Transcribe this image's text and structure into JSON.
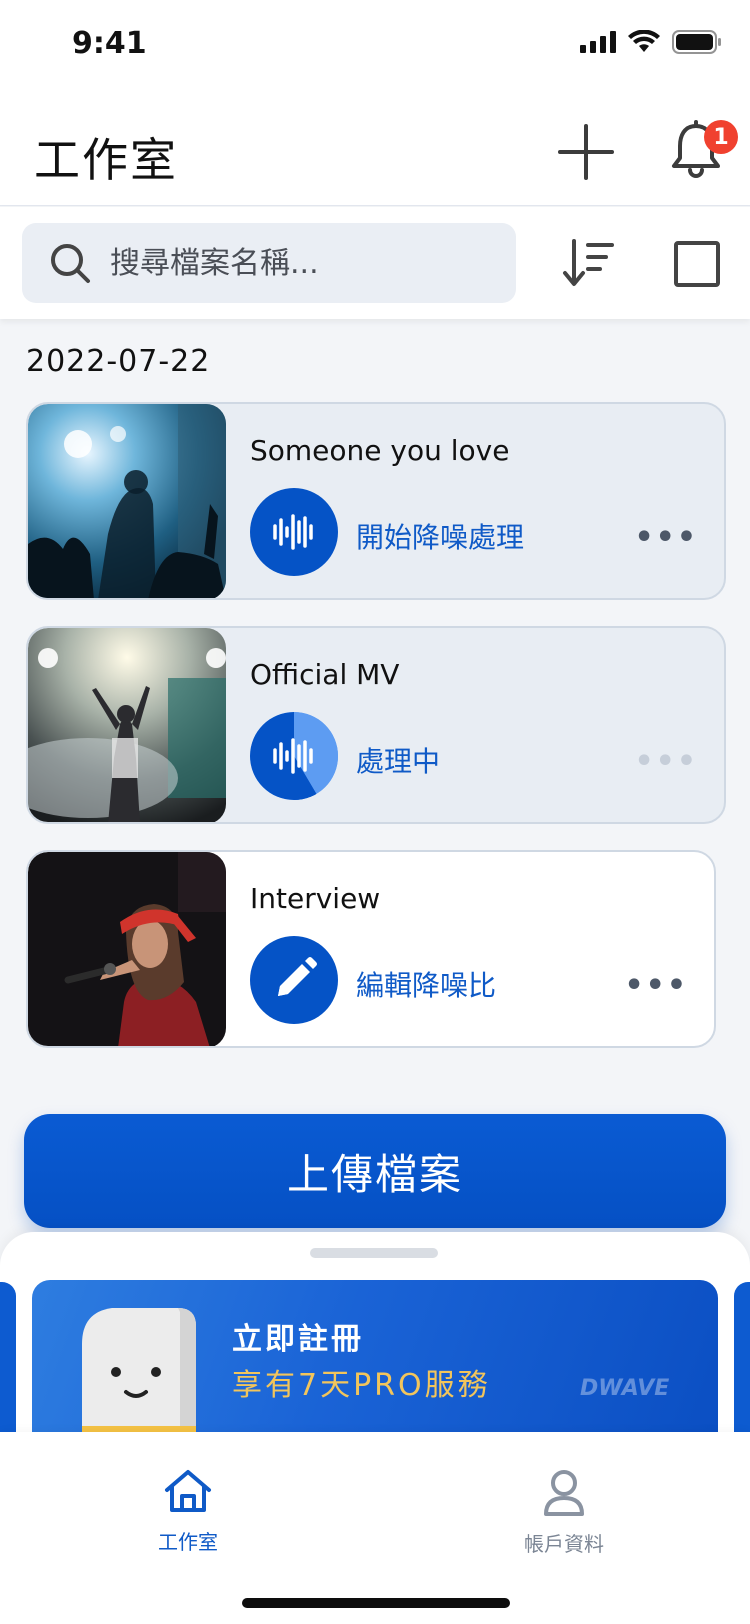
{
  "status_bar": {
    "time": "9:41"
  },
  "header": {
    "title": "工作室",
    "notification_count": "1"
  },
  "search": {
    "placeholder": "搜尋檔案名稱..."
  },
  "date_group": "2022-07-22",
  "cards": [
    {
      "title": "Someone you love",
      "action": "開始降噪處理",
      "action_icon": "waveform-icon",
      "state": "idle"
    },
    {
      "title": "Official MV",
      "action": "處理中",
      "action_icon": "waveform-icon",
      "state": "processing"
    },
    {
      "title": "Interview",
      "action": "編輯降噪比",
      "action_icon": "pencil-icon",
      "state": "done"
    }
  ],
  "more_label": "•••",
  "upload_button": "上傳檔案",
  "promo": {
    "title": "立即註冊",
    "subtitle": "享有7天PRO服務",
    "logo": "DWAVE"
  },
  "tabs": [
    {
      "label": "工作室",
      "icon": "home-icon",
      "active": true
    },
    {
      "label": "帳戶資料",
      "icon": "user-icon",
      "active": false
    }
  ],
  "colors": {
    "primary": "#0553c6",
    "badge": "#f0412f",
    "promo_subtitle": "#f2c55c"
  }
}
